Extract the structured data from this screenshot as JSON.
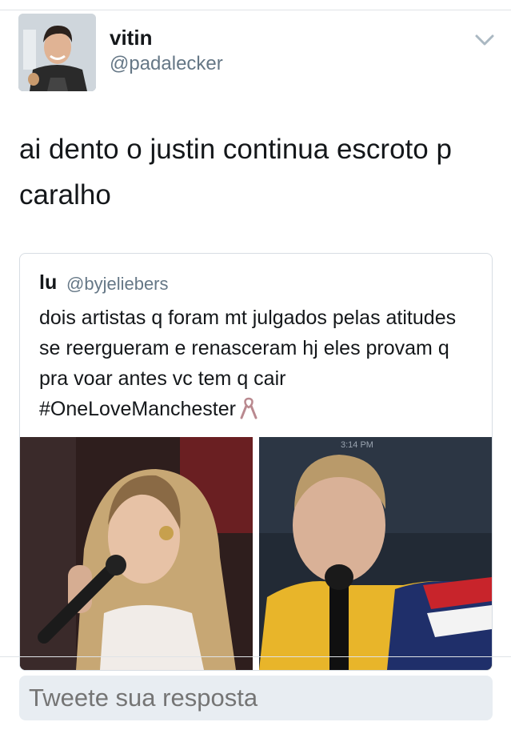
{
  "tweet": {
    "author_name": "vitin",
    "author_handle": "@padalecker",
    "text": "ai dento o justin continua escroto p caralho",
    "menu_icon": "chevron-down-icon"
  },
  "quoted_tweet": {
    "author_name": "lu",
    "author_handle": "@byjeliebers",
    "text": "dois artistas q foram mt julgados pelas atitudes se reergueram e renasceram hj eles provam q pra voar antes vc tem q cair #OneLoveManchester",
    "emoji_icon": "ribbon-icon",
    "photo_timestamp": "3:14 PM"
  },
  "reply": {
    "placeholder": "Tweete sua resposta"
  },
  "colors": {
    "text": "#14171a",
    "secondary": "#657786",
    "border": "#d7dde3",
    "reply_bg": "#e8edf2"
  }
}
